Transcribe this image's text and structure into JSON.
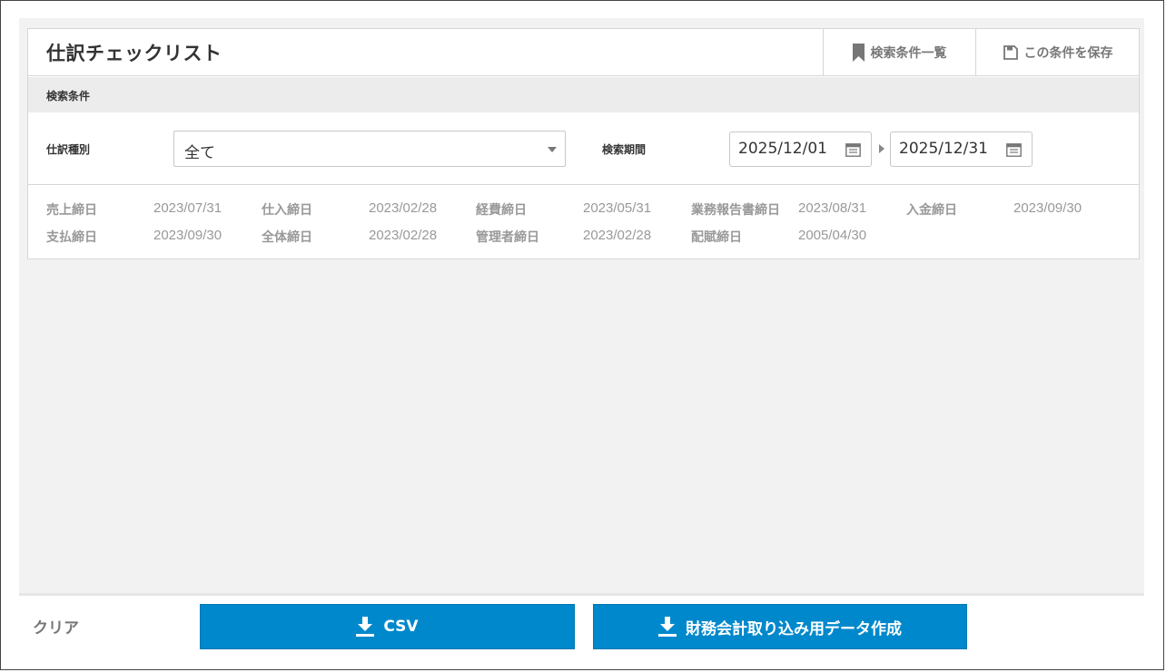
{
  "header": {
    "title": "仕訳チェックリスト",
    "search_list_label": "検索条件一覧",
    "save_condition_label": "この条件を保存"
  },
  "search": {
    "section_title": "検索条件",
    "journal_type_label": "仕訳種別",
    "journal_type_value": "全て",
    "period_label": "検索期間",
    "period_from": "2025/12/01",
    "period_to": "2025/12/31"
  },
  "closing_dates": [
    {
      "label": "売上締日",
      "value": "2023/07/31"
    },
    {
      "label": "仕入締日",
      "value": "2023/02/28"
    },
    {
      "label": "経費締日",
      "value": "2023/05/31"
    },
    {
      "label": "業務報告書締日",
      "value": "2023/08/31"
    },
    {
      "label": "入金締日",
      "value": "2023/09/30"
    },
    {
      "label": "支払締日",
      "value": "2023/09/30"
    },
    {
      "label": "全体締日",
      "value": "2023/02/28"
    },
    {
      "label": "管理者締日",
      "value": "2023/02/28"
    },
    {
      "label": "配賦締日",
      "value": "2005/04/30"
    }
  ],
  "footer": {
    "clear_label": "クリア",
    "csv_label": "CSV",
    "finance_export_label": "財務会計取り込み用データ作成"
  },
  "colors": {
    "primary": "#0088cc",
    "background": "#f2f2f2",
    "border": "#d6d6d6"
  }
}
